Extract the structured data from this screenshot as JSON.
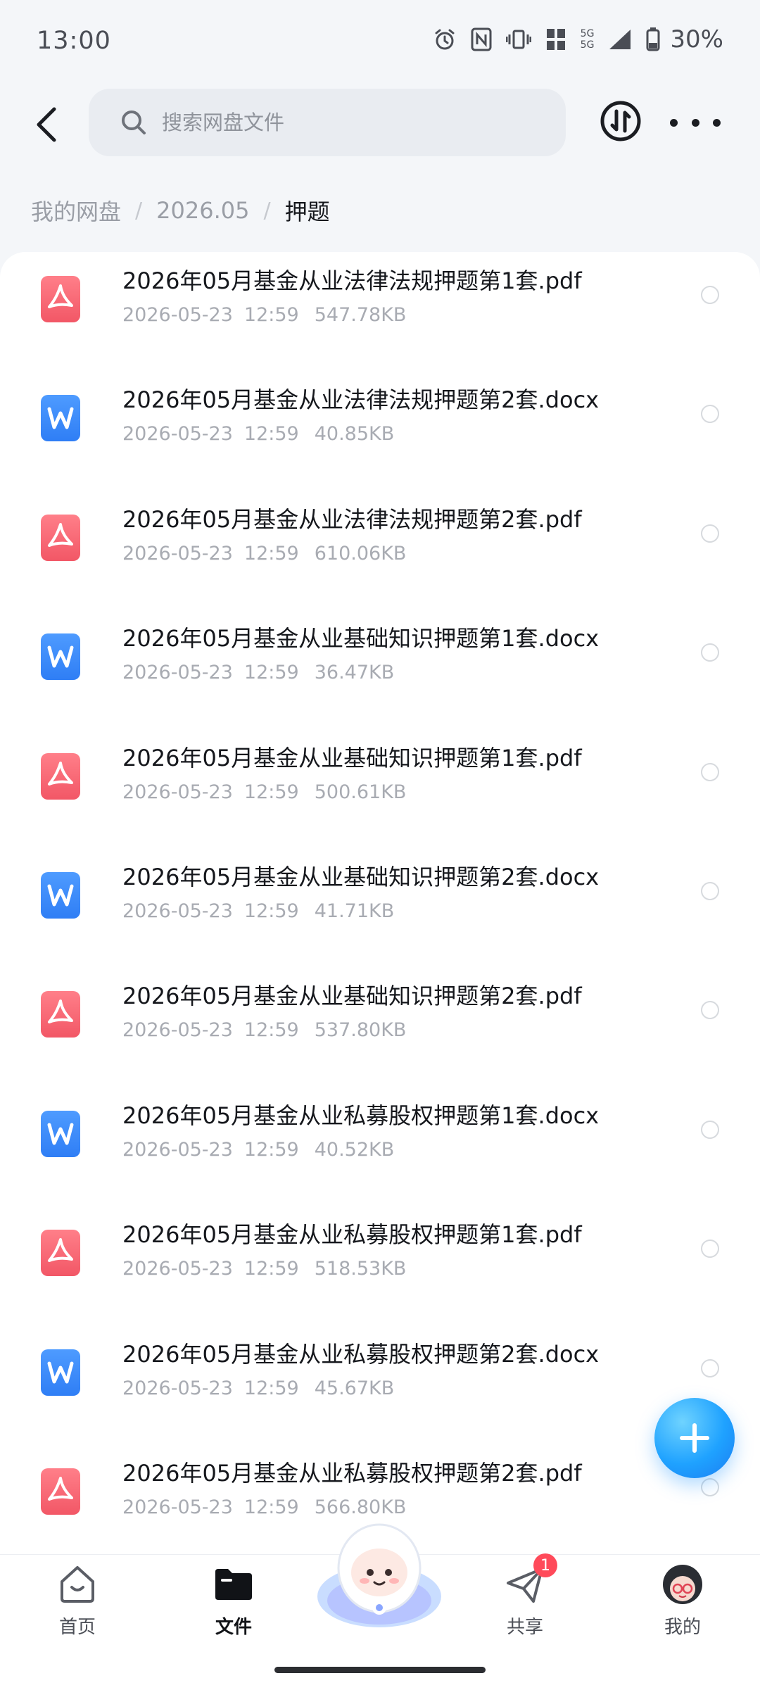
{
  "status_bar": {
    "time": "13:00",
    "network": "5G",
    "battery": "30%"
  },
  "search": {
    "placeholder": "搜索网盘文件"
  },
  "breadcrumb": {
    "root": "我的网盘",
    "folder": "2026.05",
    "current": "押题"
  },
  "files": [
    {
      "name": "2026年05月基金从业法律法规押题第1套.pdf",
      "type": "pdf",
      "date": "2026-05-23",
      "time": "12:59",
      "size": "547.78KB"
    },
    {
      "name": "2026年05月基金从业法律法规押题第2套.docx",
      "type": "docx",
      "date": "2026-05-23",
      "time": "12:59",
      "size": "40.85KB"
    },
    {
      "name": "2026年05月基金从业法律法规押题第2套.pdf",
      "type": "pdf",
      "date": "2026-05-23",
      "time": "12:59",
      "size": "610.06KB"
    },
    {
      "name": "2026年05月基金从业基础知识押题第1套.docx",
      "type": "docx",
      "date": "2026-05-23",
      "time": "12:59",
      "size": "36.47KB"
    },
    {
      "name": "2026年05月基金从业基础知识押题第1套.pdf",
      "type": "pdf",
      "date": "2026-05-23",
      "time": "12:59",
      "size": "500.61KB"
    },
    {
      "name": "2026年05月基金从业基础知识押题第2套.docx",
      "type": "docx",
      "date": "2026-05-23",
      "time": "12:59",
      "size": "41.71KB"
    },
    {
      "name": "2026年05月基金从业基础知识押题第2套.pdf",
      "type": "pdf",
      "date": "2026-05-23",
      "time": "12:59",
      "size": "537.80KB"
    },
    {
      "name": "2026年05月基金从业私募股权押题第1套.docx",
      "type": "docx",
      "date": "2026-05-23",
      "time": "12:59",
      "size": "40.52KB"
    },
    {
      "name": "2026年05月基金从业私募股权押题第1套.pdf",
      "type": "pdf",
      "date": "2026-05-23",
      "time": "12:59",
      "size": "518.53KB"
    },
    {
      "name": "2026年05月基金从业私募股权押题第2套.docx",
      "type": "docx",
      "date": "2026-05-23",
      "time": "12:59",
      "size": "45.67KB"
    },
    {
      "name": "2026年05月基金从业私募股权押题第2套.pdf",
      "type": "pdf",
      "date": "2026-05-23",
      "time": "12:59",
      "size": "566.80KB"
    }
  ],
  "nav": {
    "home": "首页",
    "files": "文件",
    "share": "共享",
    "share_badge": "1",
    "me": "我的"
  },
  "colors": {
    "pdf": "#f25766",
    "docx": "#2f7ef5",
    "fab": "#1fa2ff",
    "badge": "#ff4a5a"
  }
}
